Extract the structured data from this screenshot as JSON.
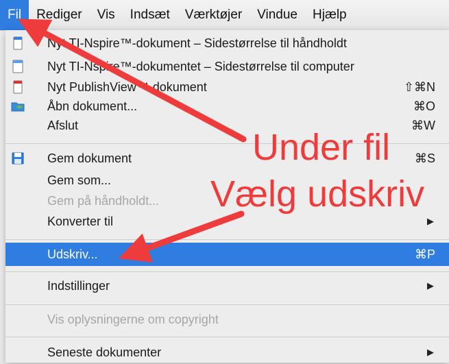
{
  "menubar": {
    "items": [
      "Fil",
      "Rediger",
      "Vis",
      "Indsæt",
      "Værktøjer",
      "Vindue",
      "Hjælp"
    ]
  },
  "menu": {
    "items": [
      {
        "label": "Nyt TI-Nspire™-dokument – Sidestørrelse til håndholdt",
        "shortcut": "",
        "icon": "handheld-document-icon"
      },
      {
        "label": "Nyt TI-Nspire™-dokumentet – Sidestørrelse til computer",
        "shortcut": "",
        "icon": "computer-document-icon"
      },
      {
        "label": "Nyt PublishView™-dokument",
        "shortcut": "⇧⌘N",
        "icon": "publishview-document-icon"
      },
      {
        "label": "Åbn dokument...",
        "shortcut": "⌘O",
        "icon": "open-folder-icon"
      },
      {
        "label": "Afslut",
        "shortcut": "⌘W"
      },
      {
        "label": "Gem dokument",
        "shortcut": "⌘S",
        "icon": "floppy-disk-icon"
      },
      {
        "label": "Gem som...",
        "shortcut": ""
      },
      {
        "label": "Gem på håndholdt...",
        "shortcut": "",
        "disabled": true
      },
      {
        "label": "Konverter til",
        "shortcut": "",
        "submenu": true
      },
      {
        "label": "Udskriv...",
        "shortcut": "⌘P",
        "selected": true
      },
      {
        "label": "Indstillinger",
        "shortcut": "",
        "submenu": true
      },
      {
        "label": "Vis oplysningerne om copyright",
        "shortcut": "",
        "disabled": true
      },
      {
        "label": "Seneste dokumenter",
        "shortcut": "",
        "submenu": true
      }
    ],
    "submenu_arrow": "▶"
  },
  "annotations": {
    "line1": "Under fil",
    "line2": "Vælg udskriv",
    "color": "#ee3b3b"
  },
  "colors": {
    "accent": "#2f7de1"
  }
}
